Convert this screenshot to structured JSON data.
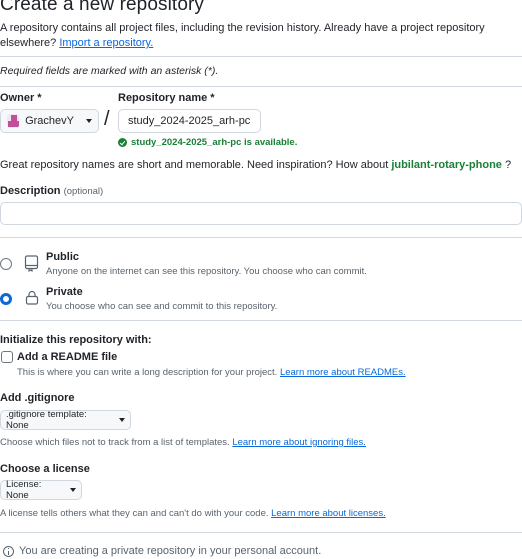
{
  "header": {
    "title": "Create a new repository",
    "intro_text": "A repository contains all project files, including the revision history. Already have a project repository elsewhere? ",
    "import_link": "Import a repository."
  },
  "required_note": "Required fields are marked with an asterisk (*).",
  "owner": {
    "label": "Owner *",
    "value": "GrachevY",
    "icon": "avatar"
  },
  "separator": "/",
  "repo_name": {
    "label": "Repository name *",
    "value": "study_2024-2025_arh-pc",
    "availability": "study_2024-2025_arh-pc is available."
  },
  "inspiration": {
    "text": "Great repository names are short and memorable. Need inspiration? How about ",
    "suggestion": "jubilant-rotary-phone",
    "suffix": " ?"
  },
  "description": {
    "label": "Description",
    "optional": "(optional)",
    "value": ""
  },
  "visibility": {
    "options": [
      {
        "title": "Public",
        "subtitle": "Anyone on the internet can see this repository. You choose who can commit.",
        "icon": "repo-icon",
        "checked": false
      },
      {
        "title": "Private",
        "subtitle": "You choose who can see and commit to this repository.",
        "icon": "lock-icon",
        "checked": true
      }
    ]
  },
  "initialize": {
    "heading": "Initialize this repository with:",
    "readme_label": "Add a README file",
    "readme_desc": "This is where you can write a long description for your project. ",
    "readme_link": "Learn more about READMEs.",
    "readme_checked": false
  },
  "gitignore": {
    "heading": "Add .gitignore",
    "button": ".gitignore template: None",
    "desc": "Choose which files not to track from a list of templates. ",
    "link": "Learn more about ignoring files."
  },
  "license": {
    "heading": "Choose a license",
    "button": "License: None",
    "desc": "A license tells others what they can and can't do with your code. ",
    "link": "Learn more about licenses."
  },
  "footer_note": "You are creating a private repository in your personal account.",
  "colors": {
    "link": "#0969da",
    "success": "#1a7f37",
    "border": "#d0d7de"
  }
}
